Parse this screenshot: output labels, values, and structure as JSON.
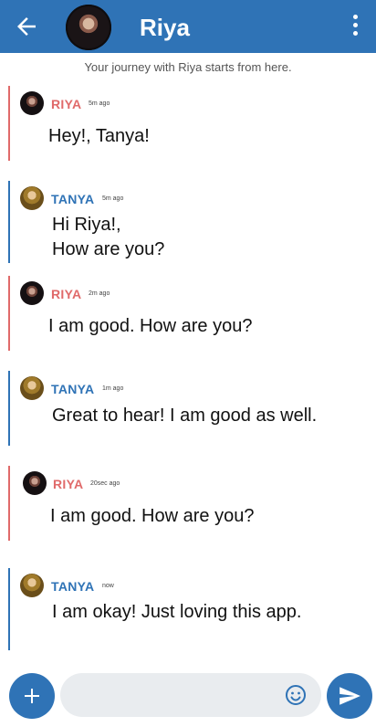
{
  "header": {
    "title": "Riya",
    "back_icon": "arrow-left-icon",
    "menu_icon": "more-vertical-icon",
    "background": "#2f73b6"
  },
  "intro": "Your journey with Riya starts from here.",
  "colors": {
    "riya": "#e06a6a",
    "tanya": "#2f73b6"
  },
  "messages": [
    {
      "sender": "RIYA",
      "time": "5m ago",
      "text": "Hey!, Tanya!"
    },
    {
      "sender": "TANYA",
      "time": "5m ago",
      "text": "Hi Riya!,\nHow are you?"
    },
    {
      "sender": "RIYA",
      "time": "2m ago",
      "text": "I am good. How are you?"
    },
    {
      "sender": "TANYA",
      "time": "1m ago",
      "text": "Great to hear! I am good as well."
    },
    {
      "sender": "RIYA",
      "time": "20sec ago",
      "text": "I am good. How are you?"
    },
    {
      "sender": "TANYA",
      "time": "now",
      "text": "I am okay! Just loving this app."
    }
  ],
  "composer": {
    "placeholder": "",
    "value": "",
    "add_icon": "plus-icon",
    "emoji_icon": "smiley-icon",
    "send_icon": "send-icon"
  }
}
